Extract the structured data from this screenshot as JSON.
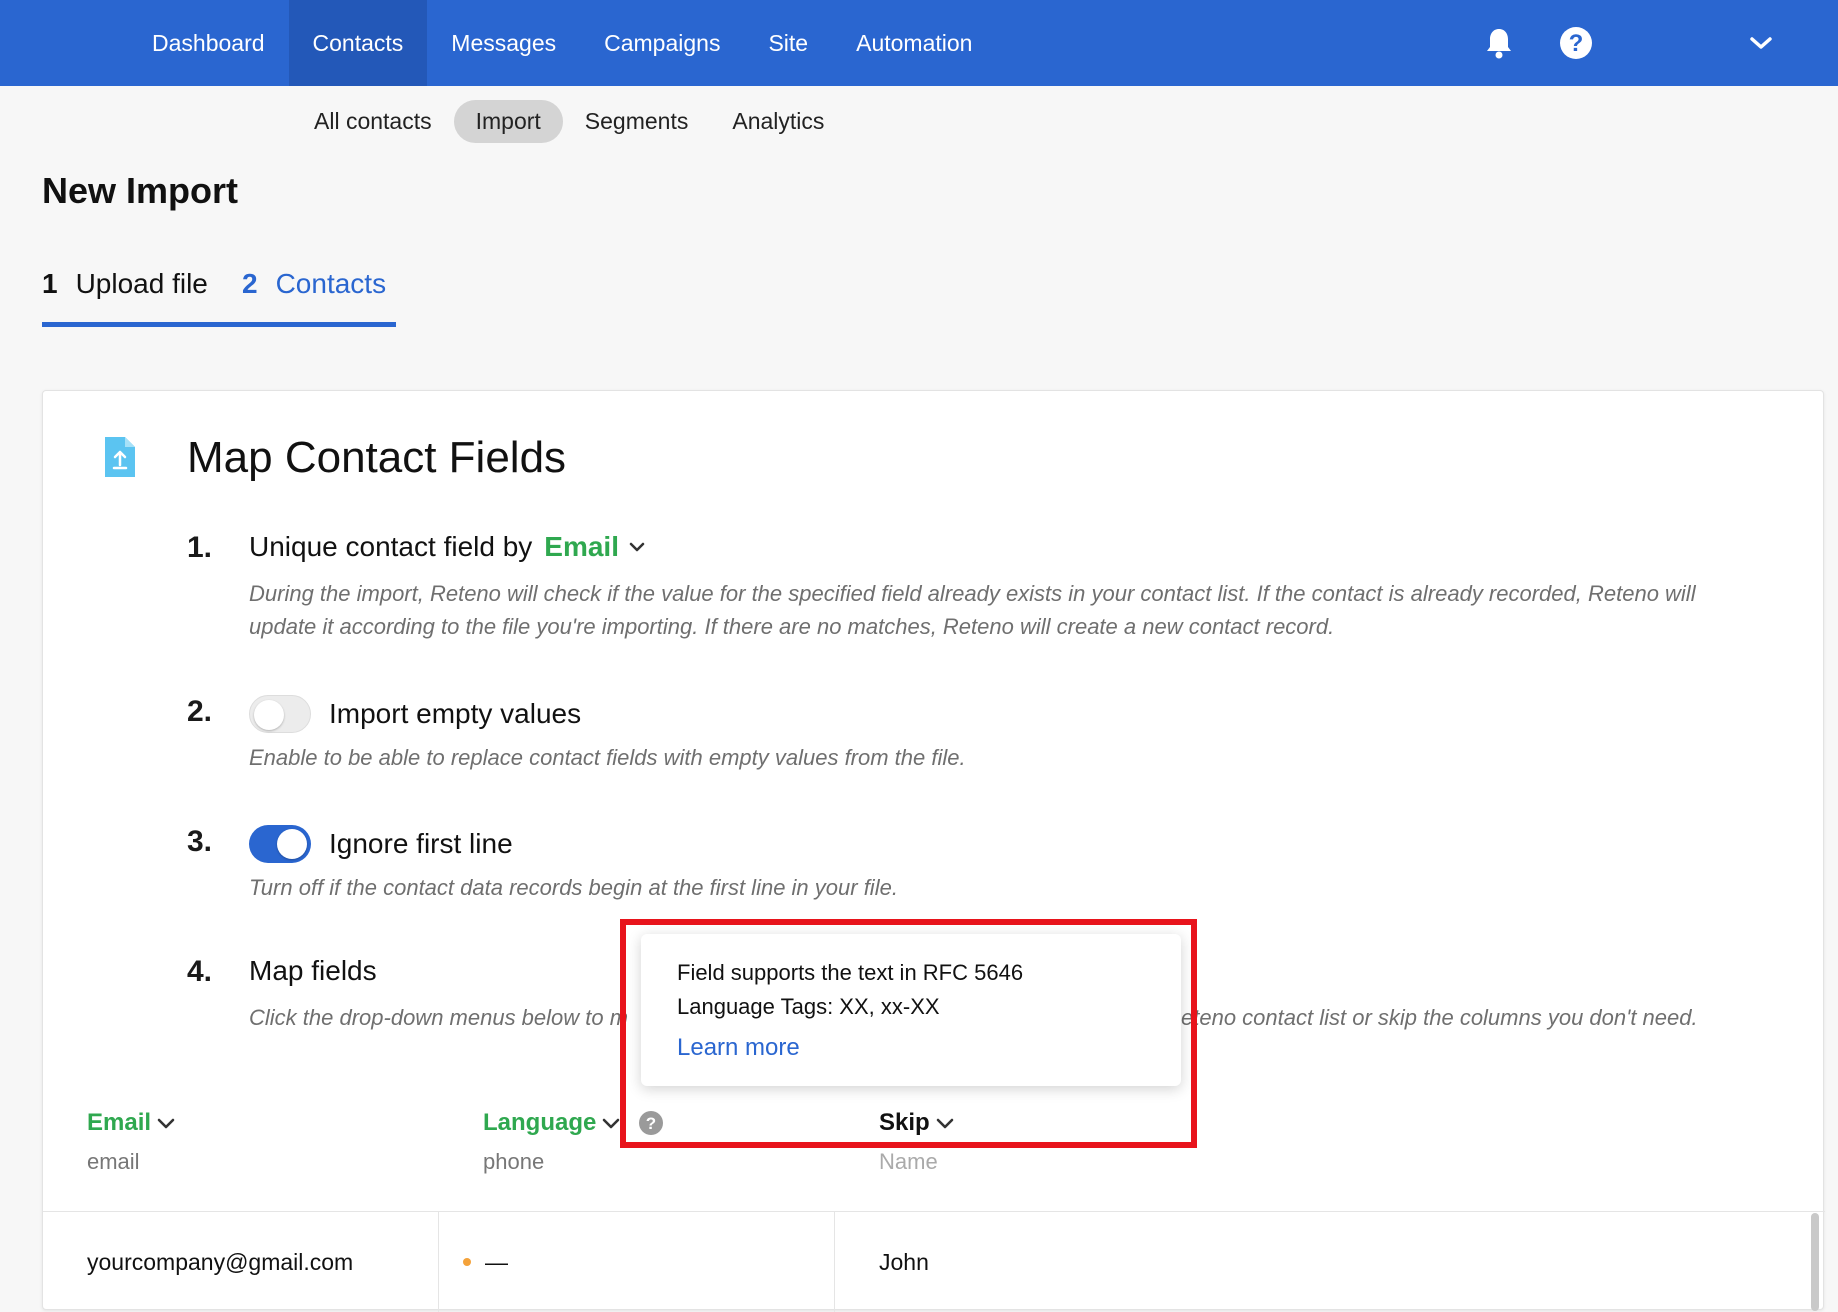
{
  "topnav": {
    "items": [
      {
        "label": "Dashboard",
        "active": false
      },
      {
        "label": "Contacts",
        "active": true
      },
      {
        "label": "Messages",
        "active": false
      },
      {
        "label": "Campaigns",
        "active": false
      },
      {
        "label": "Site",
        "active": false
      },
      {
        "label": "Automation",
        "active": false
      }
    ],
    "icons": [
      "bell-icon",
      "help-icon",
      "chevron-down-icon"
    ]
  },
  "subnav": {
    "items": [
      {
        "label": "All contacts",
        "active": false
      },
      {
        "label": "Import",
        "active": true
      },
      {
        "label": "Segments",
        "active": false
      },
      {
        "label": "Analytics",
        "active": false
      }
    ]
  },
  "page": {
    "title": "New Import"
  },
  "steps": [
    {
      "num": "1",
      "label": "Upload file"
    },
    {
      "num": "2",
      "label": "Contacts"
    }
  ],
  "card": {
    "title": "Map Contact Fields",
    "items": [
      {
        "num": "1.",
        "heading_prefix": "Unique contact field by",
        "heading_value": "Email",
        "desc": "During the import, Reteno will check if the value for the specified field already exists in your contact list. If the contact is already recorded, Reteno will update it according to the file you're importing. If there are no matches, Reteno will create a new contact record."
      },
      {
        "num": "2.",
        "heading": "Import empty values",
        "toggle_on": false,
        "desc": "Enable to be able to replace contact fields with empty values from the file."
      },
      {
        "num": "3.",
        "heading": "Ignore first line",
        "toggle_on": true,
        "desc": "Turn off if the contact data records begin at the first line in your file."
      },
      {
        "num": "4.",
        "heading": "Map fields",
        "desc_left": "Click the drop-down menus below to m",
        "desc_right": "eteno contact list or skip the columns you don't need."
      }
    ],
    "columns": [
      {
        "field": "Email",
        "source": "email",
        "color": "#2fa84f"
      },
      {
        "field": "Language",
        "source": "phone",
        "color": "#2fa84f"
      },
      {
        "field": "Skip",
        "source": "Name",
        "color": "#111111"
      }
    ],
    "row": {
      "email": "yourcompany@gmail.com",
      "language": "—",
      "skip": "John"
    }
  },
  "tooltip": {
    "line1": "Field supports the text in RFC 5646",
    "line2": "Language Tags: XX, xx-XX",
    "link": "Learn more"
  },
  "colors": {
    "brand": "#2a66d0",
    "accent_green": "#2fa84f",
    "highlight": "#e8141c"
  }
}
